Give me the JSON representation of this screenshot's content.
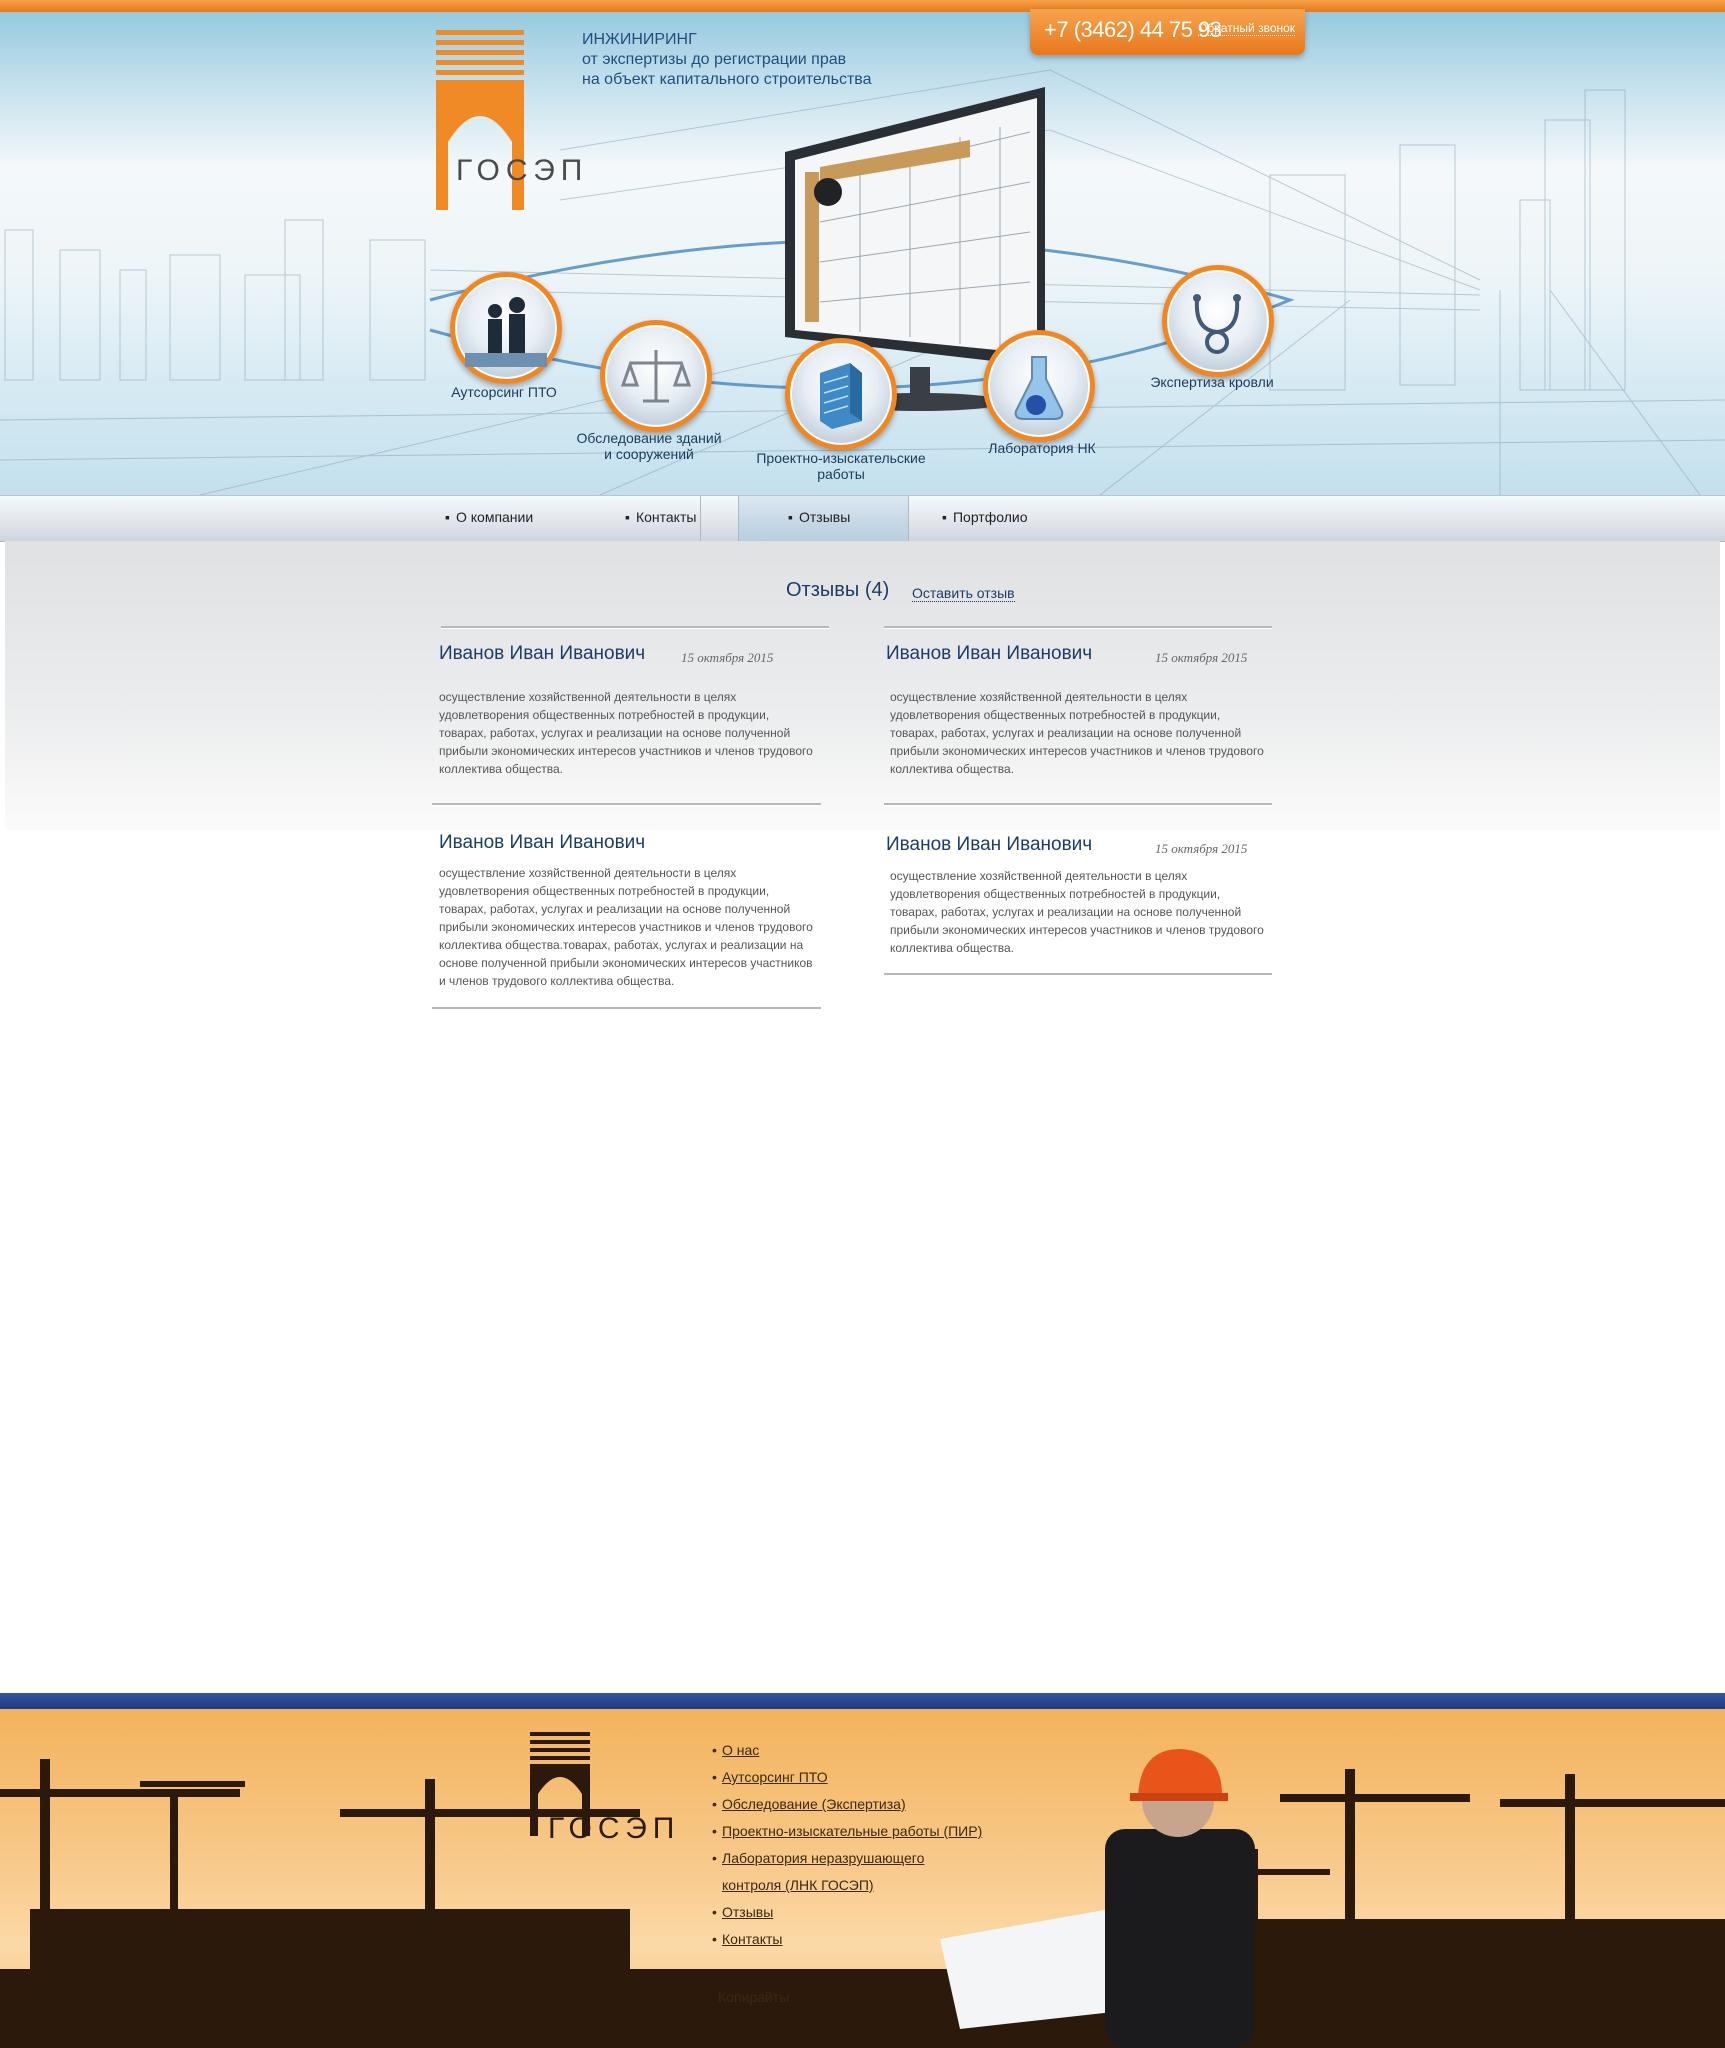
{
  "header": {
    "phone": "+7 (3462) 44 75 93",
    "callback": "Обратный звонок",
    "logo_text": "ГОСЭП",
    "tagline": [
      "ИНЖИНИРИНГ",
      "от экспертизы до регистрации прав",
      "на объект капитального строительства"
    ]
  },
  "services": [
    {
      "label": "Аутсорсинг ПТО",
      "icon": "businessmen-icon"
    },
    {
      "label": "Обследование зданий\nи сооружений",
      "icon": "scales-icon"
    },
    {
      "label": "Проектно-изыскательские\nработы",
      "icon": "building-icon"
    },
    {
      "label": "Лаборатория НК",
      "icon": "flask-icon"
    },
    {
      "label": "Экспертиза кровли",
      "icon": "stethoscope-icon"
    }
  ],
  "nav": {
    "items": [
      "О компании",
      "Контакты",
      "Отзывы",
      "Портфолио"
    ],
    "active": "Отзывы"
  },
  "reviews_section": {
    "title": "Отзывы (4)",
    "leave_link": "Оставить отзыв"
  },
  "reviews": [
    {
      "name": "Иванов Иван Иванович",
      "date": "15 октября 2015",
      "text": "осуществление хозяйственной деятельности в целях удовлетворения общественных потребностей в продукции, товарах, работах, услугах и реализации на основе полученной прибыли экономических интересов участников и членов трудового коллектива общества."
    },
    {
      "name": "Иванов Иван Иванович",
      "date": "15 октября 2015",
      "text": "осуществление хозяйственной деятельности в целях удовлетворения общественных потребностей в продукции, товарах, работах, услугах и реализации на основе полученной прибыли экономических интересов участников и членов трудового коллектива общества."
    },
    {
      "name": "Иванов Иван Иванович",
      "date": "",
      "text": "осуществление хозяйственной деятельности в целях удовлетворения общественных потребностей в продукции, товарах, работах, услугах и реализации на основе полученной прибыли экономических интересов участников и членов трудового коллектива общества.товарах, работах, услугах и реализации на основе полученной прибыли экономических интересов участников и членов трудового коллектива общества."
    },
    {
      "name": "Иванов Иван Иванович",
      "date": "15 октября 2015",
      "text": "осуществление хозяйственной деятельности в целях удовлетворения общественных потребностей в продукции, товарах, работах, услугах и реализации на основе полученной прибыли экономических интересов участников и членов трудового коллектива общества."
    }
  ],
  "footer": {
    "logo_text": "ГОСЭП",
    "menu": [
      "О нас",
      "Аутсорсинг ПТО",
      "Обследование (Экспертиза)",
      "Проектно-изыскательные работы (ПИР)",
      "Лаборатория неразрушающего",
      "контроля (ЛНК ГОСЭП)",
      "Отзывы",
      "Контакты"
    ],
    "copyright": "Копирайты"
  },
  "colors": {
    "accent": "#f08a24",
    "brand_blue": "#1c3d66",
    "footer_band": "#2a4a8f"
  }
}
